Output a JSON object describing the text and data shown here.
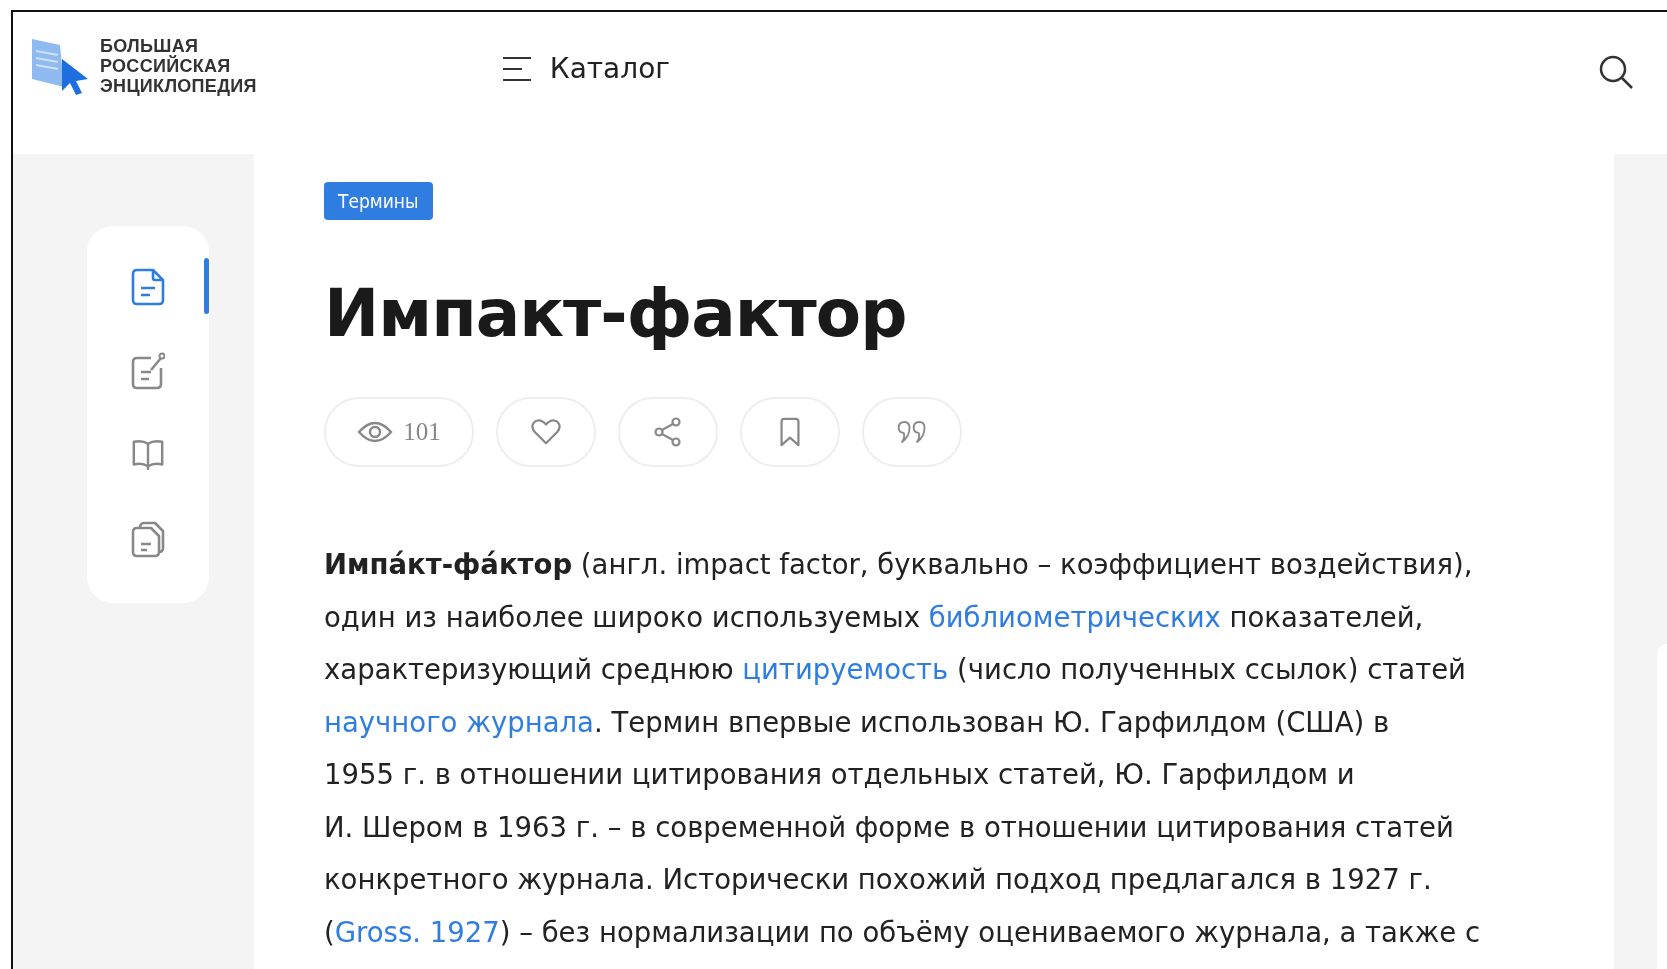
{
  "header": {
    "logo_lines": [
      "БОЛЬШАЯ",
      "РОССИЙСКАЯ",
      "ЭНЦИКЛОПЕДИЯ"
    ],
    "menu_label": "Каталог"
  },
  "sidebar": {
    "items": [
      {
        "kind": "document",
        "selected": true
      },
      {
        "kind": "note",
        "selected": false
      },
      {
        "kind": "book",
        "selected": false
      },
      {
        "kind": "copies",
        "selected": false
      }
    ]
  },
  "article": {
    "tag": "Термины",
    "title": "Импакт-фактор",
    "actions": [
      {
        "kind": "views",
        "count": "101"
      },
      {
        "kind": "like"
      },
      {
        "kind": "share"
      },
      {
        "kind": "bookmark"
      },
      {
        "kind": "quote"
      }
    ],
    "lines": [
      [
        {
          "text": "**Импа́кт-фа́ктор** (англ. impact factor, буквально – коэффициент воздействия),",
          "link": false
        }
      ],
      [
        {
          "text": "один из наиболее широко используемых ",
          "link": false
        },
        {
          "text": "библиометрических",
          "link": true
        },
        {
          "text": " показателей,",
          "link": false
        }
      ],
      [
        {
          "text": "характеризующий среднюю ",
          "link": false
        },
        {
          "text": "цитируемость",
          "link": true
        },
        {
          "text": " (число полученных ссылок) статей",
          "link": false
        }
      ],
      [
        {
          "text": "научного журнала",
          "link": true
        },
        {
          "text": ". Термин впервые использован Ю. Гарфилдом (США) в",
          "link": false
        }
      ],
      [
        {
          "text": "1955 г. в отношении цитирования отдельных статей, Ю. Гарфилдом и",
          "link": false
        }
      ],
      [
        {
          "text": "И. Шером в 1963 г. – в современной форме в отношении цитирования статей",
          "link": false
        }
      ],
      [
        {
          "text": "конкретного журнала. Исторически похожий подход предлагался в 1927 г.",
          "link": false
        }
      ],
      [
        {
          "text": "(",
          "link": false
        },
        {
          "text": "Gross. 1927",
          "link": true
        },
        {
          "text": ") – без нормализации по объёму оцениваемого журнала, а также с",
          "link": false
        }
      ]
    ]
  }
}
